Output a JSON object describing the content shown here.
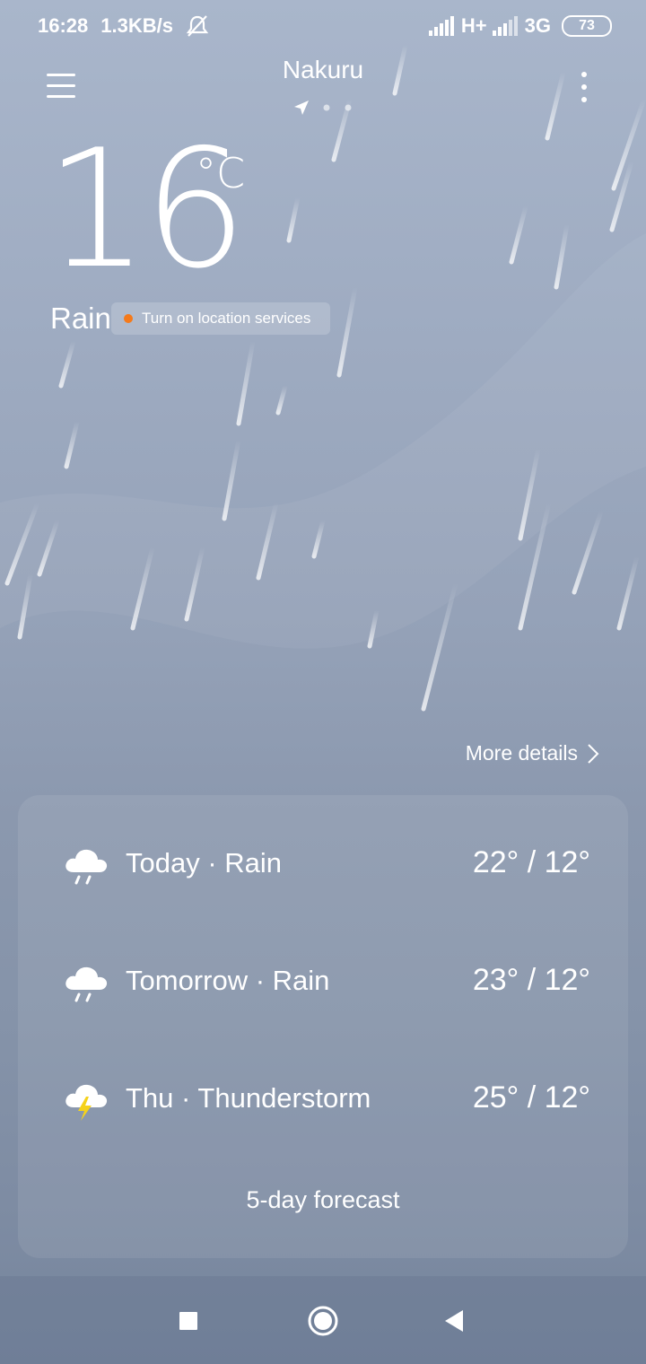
{
  "status_bar": {
    "time": "16:28",
    "speed": "1.3KB/s",
    "network_primary": "H+",
    "network_secondary": "3G",
    "battery": "73"
  },
  "header": {
    "city": "Nakuru",
    "page_count": 3,
    "current_page": 1
  },
  "current": {
    "temperature": "16",
    "unit": "°C",
    "condition": "Rain",
    "location_prompt": "Turn on location services"
  },
  "more_details": "More details",
  "forecast": {
    "rows": [
      {
        "label": "Today · Rain",
        "temps": "22° / 12°",
        "icon": "rain-cloud-icon"
      },
      {
        "label": "Tomorrow · Rain",
        "temps": "23° / 12°",
        "icon": "rain-cloud-icon"
      },
      {
        "label": "Thu · Thunderstorm",
        "temps": "25° / 12°",
        "icon": "thunderstorm-icon"
      }
    ],
    "five_day_label": "5-day forecast"
  },
  "colors": {
    "location_dot": "#f57a1b",
    "lightning": "#f5d21b"
  }
}
